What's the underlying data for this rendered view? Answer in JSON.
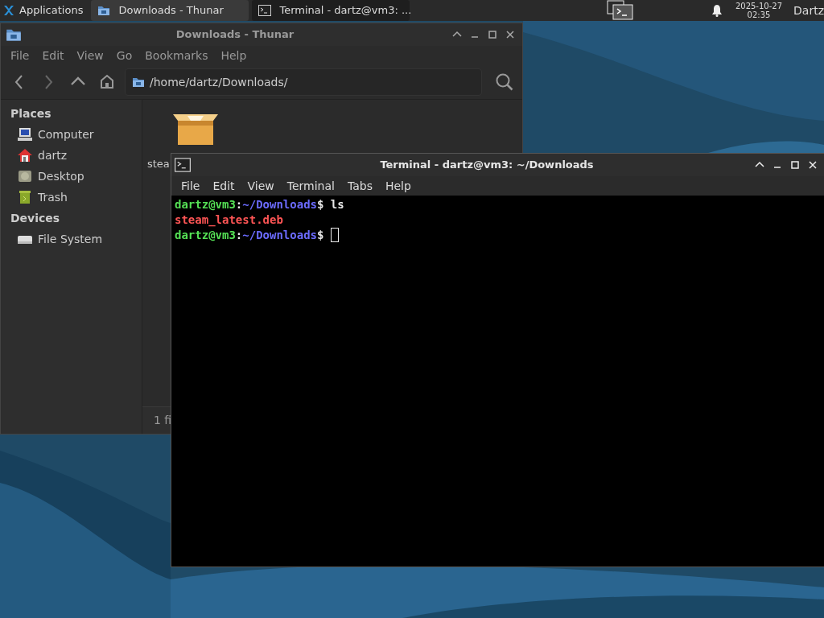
{
  "panel": {
    "apps_menu": "Applications",
    "tasks": [
      {
        "label": "Downloads - Thunar",
        "kind": "folder",
        "selected": false
      },
      {
        "label": "Terminal - dartz@vm3: ...",
        "kind": "terminal",
        "selected": true
      }
    ],
    "clock": {
      "date": "2025-10-27",
      "time": "02:35"
    },
    "user": "Dartz"
  },
  "file_manager": {
    "title": "Downloads - Thunar",
    "menu": [
      "File",
      "Edit",
      "View",
      "Go",
      "Bookmarks",
      "Help"
    ],
    "location": "/home/dartz/Downloads/",
    "sidebar": [
      {
        "heading": "Places",
        "items": [
          {
            "label": "Computer",
            "kind": "computer"
          },
          {
            "label": "dartz",
            "kind": "home"
          },
          {
            "label": "Desktop",
            "kind": "desktop"
          },
          {
            "label": "Trash",
            "kind": "trash"
          }
        ]
      },
      {
        "heading": "Devices",
        "items": [
          {
            "label": "File System",
            "kind": "drive"
          }
        ]
      }
    ],
    "files": [
      {
        "label": "stea",
        "kind": "package"
      }
    ],
    "status": "1 fi"
  },
  "terminal": {
    "title": "Terminal - dartz@vm3: ~/Downloads",
    "menu": [
      "File",
      "Edit",
      "View",
      "Terminal",
      "Tabs",
      "Help"
    ],
    "lines": [
      [
        {
          "kind": "user",
          "text": "dartz@vm3"
        },
        {
          "kind": "plain",
          "text": ":"
        },
        {
          "kind": "path",
          "text": "~/Downloads"
        },
        {
          "kind": "plain",
          "text": "$ ls"
        }
      ],
      [
        {
          "kind": "file",
          "text": "steam_latest.deb"
        }
      ],
      [
        {
          "kind": "user",
          "text": "dartz@vm3"
        },
        {
          "kind": "plain",
          "text": ":"
        },
        {
          "kind": "path",
          "text": "~/Downloads"
        },
        {
          "kind": "plain",
          "text": "$ "
        },
        {
          "kind": "cursor"
        }
      ]
    ]
  }
}
